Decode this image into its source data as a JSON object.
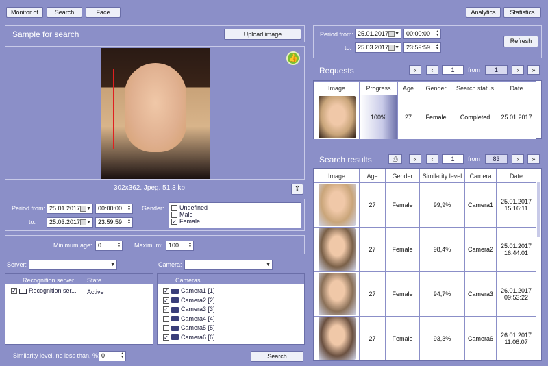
{
  "toolbar": {
    "monitor_label": "Monitor of",
    "search_label": "Search",
    "face_label": "Face",
    "analytics_label": "Analytics",
    "statistics_label": "Statistics"
  },
  "sample": {
    "title": "Sample for search",
    "upload_label": "Upload image",
    "image_info": "302x362. Jpeg. 51.3 kb"
  },
  "filter": {
    "period_from_label": "Period from:",
    "to_label": "to:",
    "date_from": "25.01.2017",
    "time_from": "00:00:00",
    "date_to": "25.03.2017",
    "time_to": "23:59:59",
    "gender_label": "Gender:",
    "gender_options": [
      {
        "label": "Undefined",
        "checked": false
      },
      {
        "label": "Male",
        "checked": false
      },
      {
        "label": "Female",
        "checked": true
      }
    ],
    "min_age_label": "Minimum age:",
    "min_age": "0",
    "max_label": "Maximum:",
    "max_age": "100",
    "server_label": "Server:",
    "camera_label": "Camera:"
  },
  "servers": {
    "col_server": "Recognition server",
    "col_state": "State",
    "rows": [
      {
        "name": "Recognition ser...",
        "state": "Active",
        "checked": true
      }
    ]
  },
  "cameras": {
    "header": "Cameras",
    "items": [
      {
        "label": "Camera1 [1]",
        "checked": true
      },
      {
        "label": "Camera2 [2]",
        "checked": true
      },
      {
        "label": "Camera3 [3]",
        "checked": true
      },
      {
        "label": "Camera4 [4]",
        "checked": false
      },
      {
        "label": "Camera5 [5]",
        "checked": false
      },
      {
        "label": "Camera6 [6]",
        "checked": true
      }
    ]
  },
  "similarity": {
    "label": "Similarity level, no less than, %:",
    "value": "0",
    "search_label": "Search"
  },
  "right_period": {
    "period_from_label": "Period from:",
    "to_label": "to:",
    "date_from": "25.01.2017",
    "time_from": "00:00:00",
    "date_to": "25.03.2017",
    "time_to": "23:59:59",
    "refresh_label": "Refresh"
  },
  "requests": {
    "title": "Requests",
    "page": "1",
    "from_label": "from",
    "total": "1",
    "columns": [
      "Image",
      "Progress",
      "Age",
      "Gender",
      "Search status",
      "Date"
    ],
    "rows": [
      {
        "progress": "100%",
        "age": "27",
        "gender": "Female",
        "status": "Completed",
        "date": "25.01.2017"
      }
    ]
  },
  "results": {
    "title": "Search results",
    "page": "1",
    "from_label": "from",
    "total": "83",
    "columns": [
      "Image",
      "Age",
      "Gender",
      "Similarity level",
      "Camera",
      "Date"
    ],
    "rows": [
      {
        "age": "27",
        "gender": "Female",
        "similarity": "99,9%",
        "camera": "Camera1",
        "date": "25.01.2017",
        "time": "15:16:11",
        "color": "#c9a57a"
      },
      {
        "age": "27",
        "gender": "Female",
        "similarity": "98,4%",
        "camera": "Camera2",
        "date": "25.01.2017",
        "time": "16:44:01",
        "color": "#7a6048"
      },
      {
        "age": "27",
        "gender": "Female",
        "similarity": "94,7%",
        "camera": "Camera3",
        "date": "26.01.2017",
        "time": "09:53:22",
        "color": "#8a7058"
      },
      {
        "age": "27",
        "gender": "Female",
        "similarity": "93,3%",
        "camera": "Camera6",
        "date": "26.01.2017",
        "time": "11:06:07",
        "color": "#6a5040"
      }
    ]
  },
  "pager_icons": {
    "first": "«",
    "prev": "‹",
    "next": "›",
    "last": "»"
  }
}
